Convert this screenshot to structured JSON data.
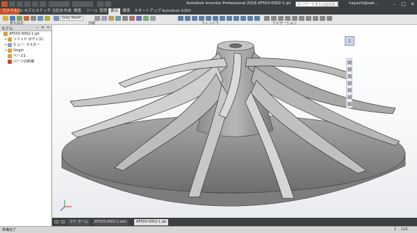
{
  "titlebar": {
    "app_title": "Autodesk Inventor Professional 2018    AF503-0002-1.ipt",
    "search_placeholder": "キーワードまたは語句を入力",
    "user": "hayashi@sab...",
    "min_label": "–",
    "max_label": "□",
    "close_label": "✕"
  },
  "ribbon_tabs": [
    "ファイル",
    "3D モデル",
    "スケッチ",
    "注記を作成",
    "検査",
    "ツール",
    "管理",
    "表示",
    "環境",
    "スタートアップ",
    "Autodesk A360"
  ],
  "ribbon": {
    "visual_style": "Grey Room",
    "panels": [
      "表示設定",
      "外観",
      "ウィンドウ",
      "ナビゲーション"
    ]
  },
  "browser": {
    "title": "モデル",
    "items": [
      {
        "label": "AF503-0002-1.ipt",
        "indent": 0,
        "color": "#d9a23a",
        "toggle": ""
      },
      {
        "label": "ソリッド ボディ(1)",
        "indent": 1,
        "color": "#d9a23a",
        "toggle": "+"
      },
      {
        "label": "ビュー: マスター",
        "indent": 1,
        "color": "#8aa0c0",
        "toggle": "+"
      },
      {
        "label": "Origin",
        "indent": 1,
        "color": "#d9a23a",
        "toggle": "+"
      },
      {
        "label": "ベース1",
        "indent": 1,
        "color": "#d9a23a",
        "toggle": ""
      },
      {
        "label": "パーツの終端",
        "indent": 1,
        "color": "#d04030",
        "toggle": ""
      }
    ]
  },
  "doc_tabs": [
    "マイ ホーム",
    "AF503-0002-1.iam",
    "AF503-0002-1.ipt"
  ],
  "status": {
    "text": "準備完了",
    "page_current": "1",
    "page_count": "115"
  },
  "viewcube": {
    "label": "上"
  },
  "colors": {
    "ribbon_bg": "#e6e6e6",
    "file_tab": "#c8552b",
    "part_metal": "#9a9a9a"
  },
  "icons": {
    "viewcube": "viewcube-icon",
    "home": "home-icon",
    "axis_triad": "axis-triad-icon"
  }
}
